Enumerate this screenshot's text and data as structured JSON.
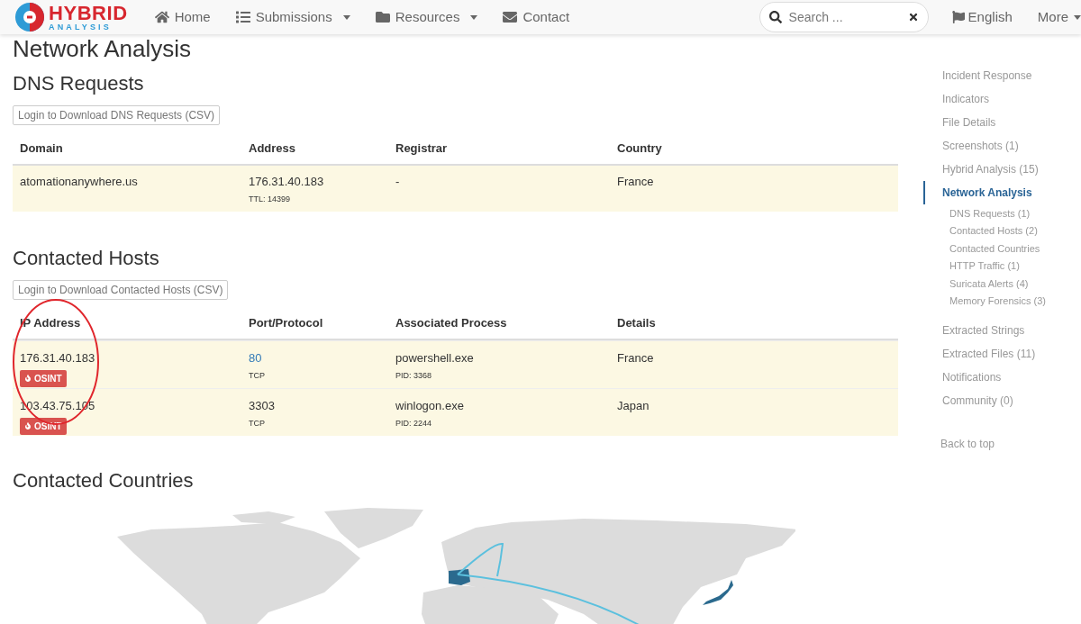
{
  "header": {
    "logo": {
      "line1": "HYBRID",
      "line2": "ANALYSIS"
    },
    "nav": [
      {
        "label": "Home",
        "dropdown": false
      },
      {
        "label": "Submissions",
        "dropdown": true
      },
      {
        "label": "Resources",
        "dropdown": true
      },
      {
        "label": "Contact",
        "dropdown": false
      }
    ],
    "search": {
      "placeholder": "Search ..."
    },
    "language": "English",
    "more": "More"
  },
  "page_title": "Network Analysis",
  "dns": {
    "title": "DNS Requests",
    "button": "Login to Download DNS Requests (CSV)",
    "columns": [
      "Domain",
      "Address",
      "Registrar",
      "Country"
    ],
    "rows": [
      {
        "domain": "atomationanywhere.us",
        "address": "176.31.40.183",
        "ttl": "TTL: 14399",
        "registrar": "-",
        "country": "France"
      }
    ]
  },
  "hosts": {
    "title": "Contacted Hosts",
    "button": "Login to Download Contacted Hosts (CSV)",
    "columns": [
      "IP Address",
      "Port/Protocol",
      "Associated Process",
      "Details"
    ],
    "annotation": {
      "kind": "circle"
    },
    "rows": [
      {
        "ip": "176.31.40.183",
        "badge": "OSINT",
        "port": "80",
        "port_link": true,
        "protocol": "TCP",
        "process": "powershell.exe",
        "pid": "PID: 3368",
        "details": "France"
      },
      {
        "ip": "103.43.75.105",
        "badge": "OSINT",
        "port": "3303",
        "port_link": false,
        "protocol": "TCP",
        "process": "winlogon.exe",
        "pid": "PID: 2244",
        "details": "Japan"
      }
    ]
  },
  "countries": {
    "title": "Contacted Countries"
  },
  "sidebar": {
    "items": [
      {
        "label": "Incident Response",
        "selected": false
      },
      {
        "label": "Indicators",
        "selected": false
      },
      {
        "label": "File Details",
        "selected": false
      },
      {
        "label": "Screenshots (1)",
        "selected": false
      },
      {
        "label": "Hybrid Analysis (15)",
        "selected": false
      },
      {
        "label": "Network Analysis",
        "selected": true,
        "children": [
          {
            "label": "DNS Requests (1)"
          },
          {
            "label": "Contacted Hosts (2)"
          },
          {
            "label": "Contacted Countries"
          },
          {
            "label": "HTTP Traffic (1)"
          },
          {
            "label": "Suricata Alerts (4)"
          },
          {
            "label": "Memory Forensics (3)"
          }
        ]
      },
      {
        "label": "Extracted Strings",
        "selected": false
      },
      {
        "label": "Extracted Files (11)",
        "selected": false
      },
      {
        "label": "Notifications",
        "selected": false
      },
      {
        "label": "Community (0)",
        "selected": false
      }
    ],
    "back_to_top": "Back to top"
  }
}
